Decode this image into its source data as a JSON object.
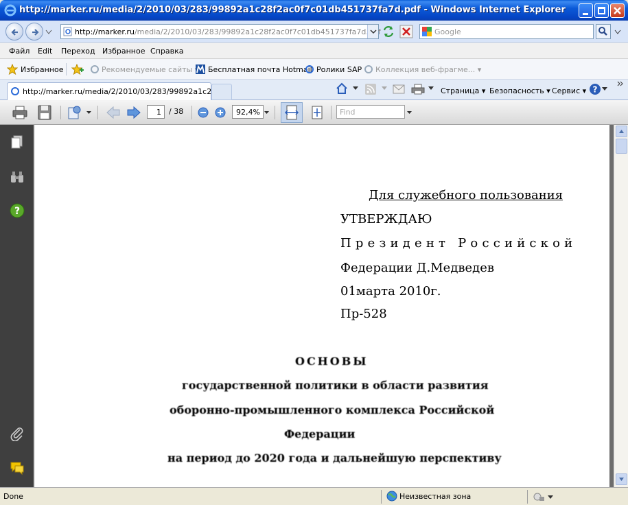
{
  "window": {
    "title": "http://marker.ru/media/2/2010/03/283/99892a1c28f2ac0f7c01db451737fa7d.pdf - Windows Internet Explorer"
  },
  "address": {
    "url_host": "http://marker.ru",
    "url_path": "/media/2/2010/03/283/99892a1c28f2ac0f7c01db451737fa7d.pdf",
    "search_placeholder": "Google"
  },
  "menu": [
    "Файл",
    "Edit",
    "Переход",
    "Избранное",
    "Справка"
  ],
  "favorites": {
    "label": "Избранное",
    "items": [
      "Рекомендуемые сайты ▾",
      "Бесплатная почта Hotmail",
      "Ролики SAP",
      "Коллекция веб-фрагме... ▾"
    ]
  },
  "tab": {
    "label": "http://marker.ru/media/2/2010/03/283/99892a1c28f..."
  },
  "commands": [
    "Страница ▾",
    "Безопасность ▾",
    "Сервис ▾"
  ],
  "pdf_toolbar": {
    "page": "1",
    "total": "/ 38",
    "zoom": "92,4%",
    "find_placeholder": "Find"
  },
  "document": {
    "classification": "Для служебного пользования",
    "approve": "УТВЕРЖДАЮ",
    "president": "Президент Российской",
    "federation": "Федерации Д.Медведев",
    "date": "01марта 2010г.",
    "number": "Пр-528",
    "heading": "ОСНОВЫ",
    "heading_line2": "государственной политики в области развития",
    "heading_line3": "оборонно-промышленного комплекса Российской",
    "heading_line4": "Федерации",
    "heading_line5": "на период до 2020 года и дальнейшую перспективу"
  },
  "status": {
    "text": "Done",
    "zone": "Неизвестная зона"
  },
  "colors": {
    "titlebar": "#0b5ad8",
    "pdf_side": "#3f3f3f",
    "pdf_background": "#6d6d6d"
  }
}
